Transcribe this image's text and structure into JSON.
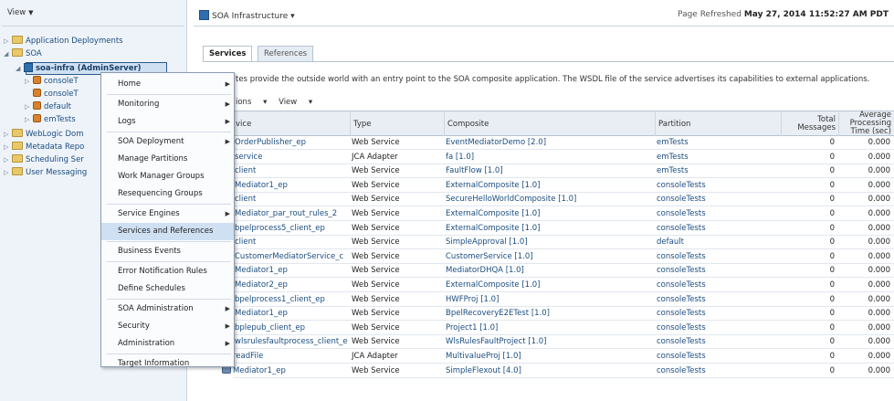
{
  "nav": {
    "view_label": "View",
    "tree": [
      {
        "label": "Application Deployments",
        "icon": "folder-icon",
        "toggle": "▷"
      },
      {
        "label": "SOA",
        "icon": "folder-icon",
        "toggle": "◢"
      },
      {
        "label": "soa-infra (AdminServer)",
        "icon": "soa-server-icon",
        "toggle": "◢"
      },
      {
        "label": "consoleT",
        "icon": "composite-partition-icon",
        "toggle": "▷"
      },
      {
        "label": "consoleT",
        "icon": "composite-partition-icon",
        "toggle": ""
      },
      {
        "label": "default",
        "icon": "composite-partition-icon",
        "toggle": "▷"
      },
      {
        "label": "emTests",
        "icon": "composite-partition-icon",
        "toggle": "▷"
      },
      {
        "label": "WebLogic Dom",
        "icon": "folder-icon",
        "toggle": "▷"
      },
      {
        "label": "Metadata Repo",
        "icon": "folder-icon",
        "toggle": "▷"
      },
      {
        "label": "Scheduling Ser",
        "icon": "folder-icon",
        "toggle": "▷"
      },
      {
        "label": "User Messaging",
        "icon": "folder-icon",
        "toggle": "▷"
      }
    ]
  },
  "header": {
    "title": "SOA Infrastructure",
    "refresh_prefix": "Page Refreshed",
    "refresh_time": "May 27, 2014 11:52:27 AM PDT"
  },
  "tabs": [
    {
      "label": "Services",
      "active": true
    },
    {
      "label": "References",
      "active": false
    }
  ],
  "description": "tes provide the outside world with an entry point to the SOA composite application. The WSDL file of the service advertises its capabilities to external applications.",
  "toolbar": {
    "actions_label": "ions",
    "view_label": "View"
  },
  "grid": {
    "columns": [
      "vice",
      "Type",
      "Composite",
      "Partition",
      "Total Messages",
      "Average Processing Time (sec)"
    ],
    "rows": [
      [
        "OrderPublisher_ep",
        "Web Service",
        "EventMediatorDemo [2.0]",
        "emTests",
        "0",
        "0.000"
      ],
      [
        "service",
        "JCA Adapter",
        "fa [1.0]",
        "emTests",
        "0",
        "0.000"
      ],
      [
        "client",
        "Web Service",
        "FaultFlow [1.0]",
        "emTests",
        "0",
        "0.000"
      ],
      [
        "Mediator1_ep",
        "Web Service",
        "ExternalComposite [1.0]",
        "consoleTests",
        "0",
        "0.000"
      ],
      [
        "client",
        "Web Service",
        "SecureHelloWorldComposite [1.0]",
        "consoleTests",
        "0",
        "0.000"
      ],
      [
        "Mediator_par_rout_rules_2",
        "Web Service",
        "ExternalComposite [1.0]",
        "consoleTests",
        "0",
        "0.000"
      ],
      [
        "bpelprocess5_client_ep",
        "Web Service",
        "ExternalComposite [1.0]",
        "consoleTests",
        "0",
        "0.000"
      ],
      [
        "client",
        "Web Service",
        "SimpleApproval [1.0]",
        "default",
        "0",
        "0.000"
      ],
      [
        "CustomerMediatorService_c",
        "Web Service",
        "CustomerService [1.0]",
        "consoleTests",
        "0",
        "0.000"
      ],
      [
        "Mediator1_ep",
        "Web Service",
        "MediatorDHQA [1.0]",
        "consoleTests",
        "0",
        "0.000"
      ],
      [
        "Mediator2_ep",
        "Web Service",
        "ExternalComposite [1.0]",
        "consoleTests",
        "0",
        "0.000"
      ],
      [
        "bpelprocess1_client_ep",
        "Web Service",
        "HWFProj [1.0]",
        "consoleTests",
        "0",
        "0.000"
      ],
      [
        "Mediator1_ep",
        "Web Service",
        "BpelRecoveryE2ETest [1.0]",
        "consoleTests",
        "0",
        "0.000"
      ],
      [
        "bplepub_client_ep",
        "Web Service",
        "Project1 [1.0]",
        "consoleTests",
        "0",
        "0.000"
      ],
      [
        "wlsrulesfaultprocess_client_e",
        "Web Service",
        "WlsRulesFaultProject [1.0]",
        "consoleTests",
        "0",
        "0.000"
      ],
      [
        "readFile",
        "JCA Adapter",
        "MultivalueProj [1.0]",
        "consoleTests",
        "0",
        "0.000"
      ],
      [
        "Mediator1_ep",
        "Web Service",
        "SimpleFlexout [4.0]",
        "consoleTests",
        "0",
        "0.000"
      ]
    ]
  },
  "context_menu": {
    "items": [
      {
        "label": "Home",
        "submenu": true
      },
      {
        "sep": true
      },
      {
        "label": "Monitoring",
        "submenu": true
      },
      {
        "label": "Logs",
        "submenu": true
      },
      {
        "sep": true
      },
      {
        "label": "SOA Deployment",
        "submenu": true
      },
      {
        "label": "Manage Partitions",
        "submenu": false
      },
      {
        "label": "Work Manager Groups",
        "submenu": false
      },
      {
        "label": "Resequencing Groups",
        "submenu": false
      },
      {
        "sep": true
      },
      {
        "label": "Service Engines",
        "submenu": true
      },
      {
        "label": "Services and References",
        "submenu": false,
        "highlighted": true
      },
      {
        "sep": true
      },
      {
        "label": "Business Events",
        "submenu": false
      },
      {
        "sep": true
      },
      {
        "label": "Error Notification Rules",
        "submenu": false
      },
      {
        "label": "Define Schedules",
        "submenu": false
      },
      {
        "sep": true
      },
      {
        "label": "SOA Administration",
        "submenu": true
      },
      {
        "label": "Security",
        "submenu": true
      },
      {
        "label": "Administration",
        "submenu": true
      },
      {
        "sep": true
      },
      {
        "label": "Target Information",
        "submenu": false
      }
    ]
  }
}
